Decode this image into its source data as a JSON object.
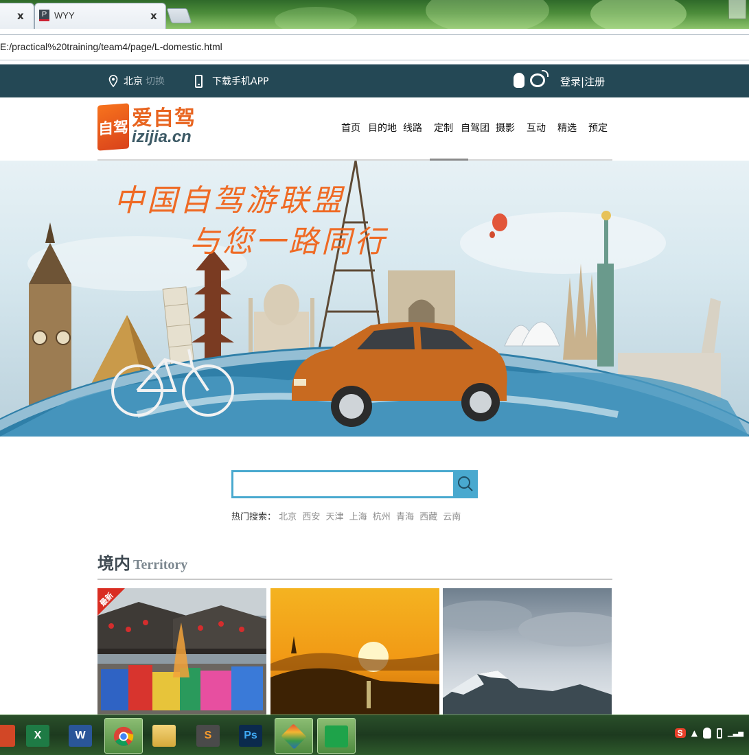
{
  "browser": {
    "tabs": [
      {
        "title": "",
        "close": "x"
      },
      {
        "favicon": "P",
        "title": "WYY",
        "close": "x"
      }
    ],
    "url": "E:/practical%20training/team4/page/L-domestic.html"
  },
  "topbar": {
    "city": "北京",
    "switch_label": "切换",
    "app_label": "下载手机APP",
    "login": "登录",
    "separator": "|",
    "register": "注册",
    "icons": [
      "location-pin-icon",
      "phone-icon",
      "qq-icon",
      "weibo-icon"
    ]
  },
  "header": {
    "logo_badge": "自驾",
    "logo_cn": "爱自驾",
    "logo_en": "izijia.cn",
    "nav": [
      "首页",
      "目的地",
      "线路",
      "定制",
      "自驾团",
      "摄影",
      "互动",
      "精选",
      "预定"
    ]
  },
  "banner": {
    "slogan_line1": "中国自驾游联盟",
    "slogan_line2": "与您一路同行"
  },
  "search": {
    "value": "",
    "placeholder": "",
    "hot_label": "热门搜索：",
    "hot_items": [
      "北京",
      "西安",
      "天津",
      "上海",
      "杭州",
      "青海",
      "西藏",
      "云南"
    ]
  },
  "section": {
    "title_cn": "境内",
    "title_en": "Territory",
    "badge": "最新"
  },
  "taskbar": {
    "apps": [
      "powerpoint",
      "excel",
      "word",
      "chrome",
      "explorer",
      "sublime",
      "photoshop",
      "xmind",
      "app"
    ],
    "icon_letters": {
      "excel": "X",
      "word": "W",
      "sublime": "S",
      "photoshop": "Ps"
    },
    "tray_ime": "S"
  },
  "colors": {
    "topbar_bg": "#244855",
    "accent_orange": "#ef6a24",
    "search_blue": "#49a9cf"
  }
}
